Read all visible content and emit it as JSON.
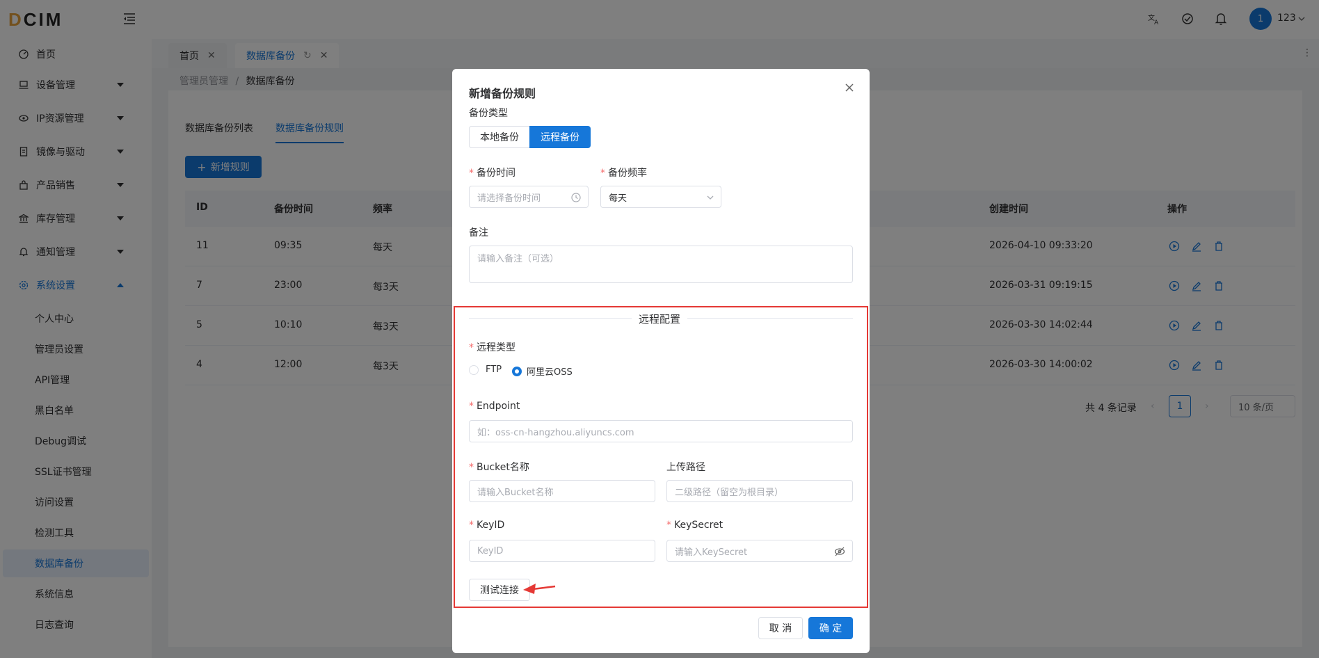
{
  "app": {
    "logo_prefix": "D",
    "logo_rest": "CIM"
  },
  "topbar": {
    "avatar_text": "1",
    "username": "123"
  },
  "sidebar": {
    "items": [
      {
        "label": "首页"
      },
      {
        "label": "设备管理"
      },
      {
        "label": "IP资源管理"
      },
      {
        "label": "镜像与驱动"
      },
      {
        "label": "产品销售"
      },
      {
        "label": "库存管理"
      },
      {
        "label": "通知管理"
      },
      {
        "label": "系统设置"
      }
    ],
    "sub_items": [
      {
        "label": "个人中心"
      },
      {
        "label": "管理员设置"
      },
      {
        "label": "API管理"
      },
      {
        "label": "黑白名单"
      },
      {
        "label": "Debug调试"
      },
      {
        "label": "SSL证书管理"
      },
      {
        "label": "访问设置"
      },
      {
        "label": "检测工具"
      },
      {
        "label": "数据库备份"
      },
      {
        "label": "系统信息"
      },
      {
        "label": "日志查询"
      }
    ]
  },
  "tabs": [
    {
      "label": "首页"
    },
    {
      "label": "数据库备份"
    }
  ],
  "breadcrumb": {
    "parent": "管理员管理",
    "sep": "/",
    "current": "数据库备份"
  },
  "page_tabs": [
    {
      "label": "数据库备份列表"
    },
    {
      "label": "数据库备份规则"
    }
  ],
  "add_rule_label": "新增规则",
  "table": {
    "headers": {
      "id": "ID",
      "time": "备份时间",
      "freq": "频率",
      "created": "创建时间",
      "ops": "操作"
    },
    "rows": [
      {
        "id": "11",
        "time": "09:35",
        "freq": "每天",
        "created": "2026-04-10 09:33:20"
      },
      {
        "id": "7",
        "time": "23:00",
        "freq": "每3天",
        "created": "2026-03-31 09:19:15"
      },
      {
        "id": "5",
        "time": "10:10",
        "freq": "每3天",
        "created": "2026-03-30 14:02:44"
      },
      {
        "id": "4",
        "time": "12:00",
        "freq": "每3天",
        "created": "2026-03-30 14:00:02"
      }
    ]
  },
  "pagination": {
    "total": "共 4 条记录",
    "page": "1",
    "page_size": "10 条/页"
  },
  "dialog": {
    "title": "新增备份规则",
    "backup_type_label": "备份类型",
    "backup_type_local": "本地备份",
    "backup_type_remote": "远程备份",
    "backup_time_label": "备份时间",
    "backup_time_placeholder": "请选择备份时间",
    "backup_freq_label": "备份频率",
    "backup_freq_value": "每天",
    "note_label": "备注",
    "note_placeholder": "请输入备注（可选）",
    "remote_section_title": "远程配置",
    "remote_type_label": "远程类型",
    "remote_type_ftp": "FTP",
    "remote_type_oss": "阿里云OSS",
    "endpoint_label": "Endpoint",
    "endpoint_placeholder": "如：oss-cn-hangzhou.aliyuncs.com",
    "bucket_label": "Bucket名称",
    "bucket_placeholder": "请输入Bucket名称",
    "upload_path_label": "上传路径",
    "upload_path_placeholder": "二级路径（留空为根目录）",
    "keyid_label": "KeyID",
    "keyid_placeholder": "KeyID",
    "keysecret_label": "KeySecret",
    "keysecret_placeholder": "请输入KeySecret",
    "test_button": "测试连接",
    "cancel_button": "取 消",
    "confirm_button": "确 定"
  },
  "colors": {
    "primary": "#1677d9",
    "highlight": "#e53935",
    "required": "#f56c6c"
  }
}
